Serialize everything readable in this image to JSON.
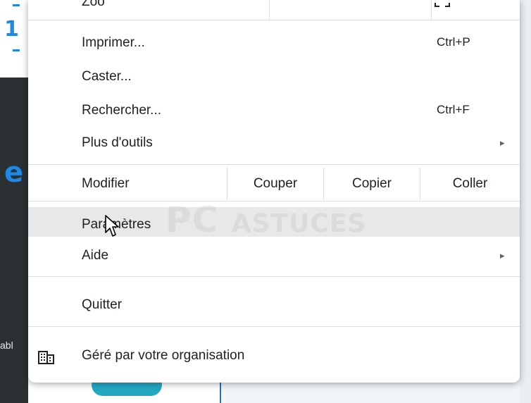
{
  "background": {
    "left_glyph_top": "1",
    "left_glyph_mid": "e",
    "left_text": "abl"
  },
  "menu": {
    "items": [
      {
        "label": "Imprimer...",
        "shortcut": "Ctrl+P"
      },
      {
        "label": "Caster..."
      },
      {
        "label": "Rechercher...",
        "shortcut": "Ctrl+F"
      },
      {
        "label": "Plus d'outils",
        "submenu_arrow": "▸"
      }
    ],
    "edit": {
      "label": "Modifier",
      "cut": "Couper",
      "copy": "Copier",
      "paste": "Coller"
    },
    "settings": {
      "label": "Paramètres"
    },
    "help": {
      "label": "Aide",
      "submenu_arrow": "▸"
    },
    "quit": {
      "label": "Quitter"
    },
    "managed": {
      "label": "Géré par votre organisation",
      "icon": "building-icon"
    }
  },
  "watermark": {
    "brand": "PC",
    "name": "ASTUCES"
  },
  "colors": {
    "accent": "#1e88e5",
    "menu_bg": "#ffffff",
    "hover_bg": "#e8e8e8",
    "divider": "#d9dce0",
    "sidebar_dark": "#2b3033",
    "pill": "#23a8c4"
  }
}
